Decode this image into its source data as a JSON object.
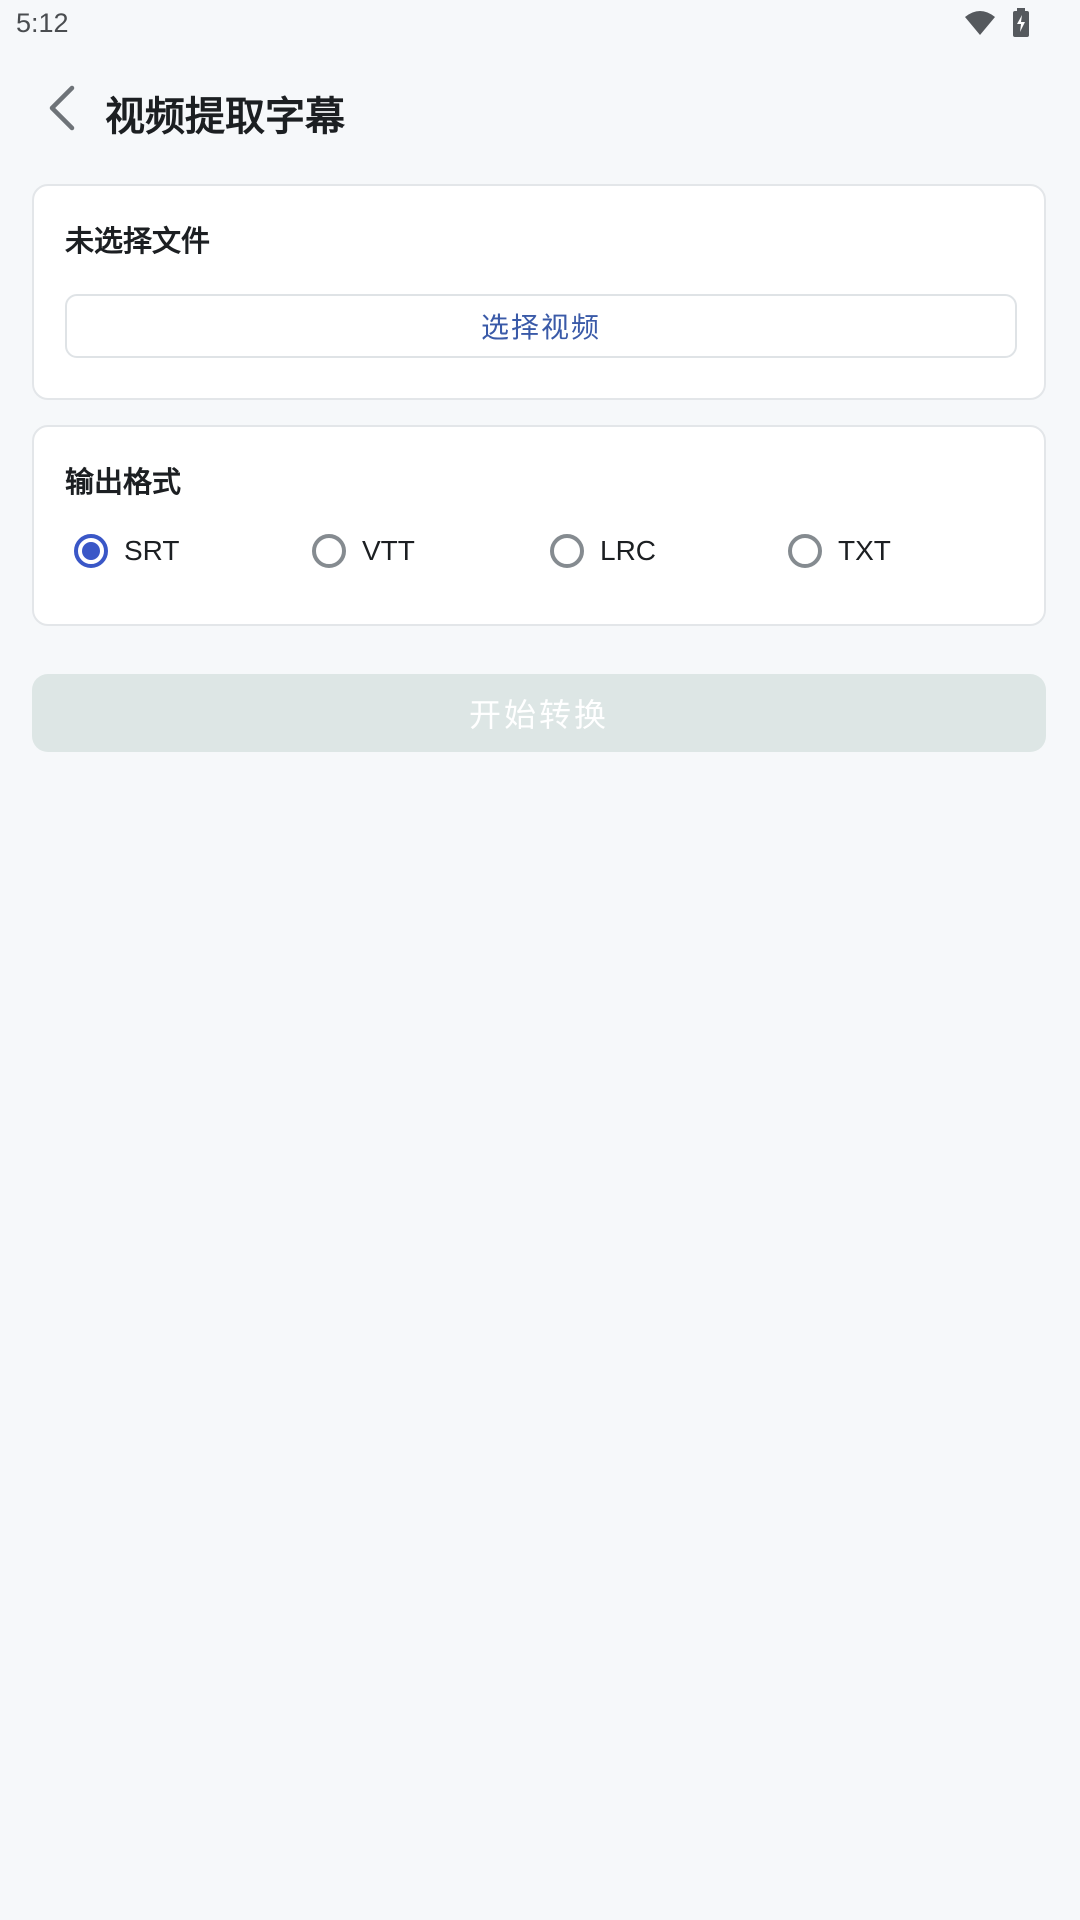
{
  "status_bar": {
    "time": "5:12",
    "icons": [
      "wifi-icon",
      "battery-charging-icon"
    ]
  },
  "app_bar": {
    "title": "视频提取字幕",
    "back_icon": "chevron-left-icon"
  },
  "file_card": {
    "status_text": "未选择文件",
    "select_button_label": "选择视频"
  },
  "format_card": {
    "label": "输出格式",
    "options": [
      "SRT",
      "VTT",
      "LRC",
      "TXT"
    ],
    "selected": "SRT"
  },
  "start_button": {
    "label": "开始转换",
    "enabled": false
  },
  "colors": {
    "background": "#f6f8fa",
    "accent": "#3a57c7",
    "button_text": "#3a5aa8",
    "disabled_button": "#dde6e5"
  }
}
